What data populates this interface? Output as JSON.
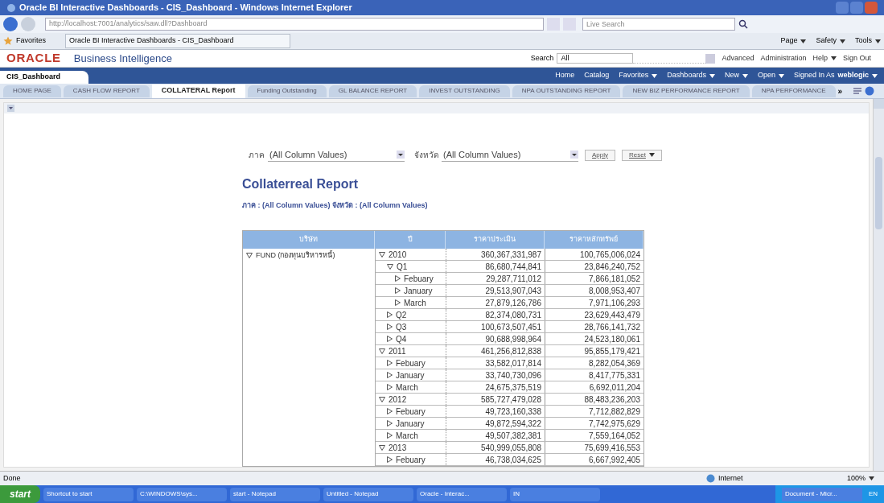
{
  "window": {
    "title": "Oracle BI Interactive Dashboards - CIS_Dashboard - Windows Internet Explorer"
  },
  "browser": {
    "address": "http://localhost:7001/analytics/saw.dll?Dashboard",
    "search_placeholder": "Live Search",
    "favorites": "Favorites",
    "page_tab": "Oracle BI Interactive Dashboards - CIS_Dashboard",
    "commands": [
      "Page",
      "Safety",
      "Tools"
    ]
  },
  "header": {
    "logo": "ORACLE",
    "product": "Business Intelligence",
    "search_label": "Search",
    "search_scope": "All",
    "links": [
      {
        "label": "Advanced",
        "menu": false
      },
      {
        "label": "Administration",
        "menu": false
      },
      {
        "label": "Help",
        "menu": true
      },
      {
        "label": "Sign Out",
        "menu": false
      }
    ]
  },
  "nav": {
    "dashboard": "CIS_Dashboard",
    "items": [
      {
        "label": "Home",
        "menu": false
      },
      {
        "label": "Catalog",
        "menu": false
      },
      {
        "label": "Favorites",
        "menu": true
      },
      {
        "label": "Dashboards",
        "menu": true
      },
      {
        "label": "New",
        "menu": true
      },
      {
        "label": "Open",
        "menu": true
      }
    ],
    "signed_in_label": "Signed In As",
    "user": "weblogic"
  },
  "tabs": [
    {
      "label": "HOME PAGE",
      "selected": false
    },
    {
      "label": "CASH FLOW REPORT",
      "selected": false
    },
    {
      "label": "COLLATERAL Report",
      "selected": true
    },
    {
      "label": "Funding Outstanding",
      "selected": false
    },
    {
      "label": "GL BALANCE REPORT",
      "selected": false
    },
    {
      "label": "INVEST OUTSTANDING",
      "selected": false
    },
    {
      "label": "NPA OUTSTANDING REPORT",
      "selected": false
    },
    {
      "label": "NEW BIZ PERFORMANCE REPORT",
      "selected": false
    },
    {
      "label": "NPA PERFORMANCE",
      "selected": false
    }
  ],
  "tabs_more": "»",
  "filters": [
    {
      "label": "ภาค",
      "value": "(All Column Values)"
    },
    {
      "label": "จังหวัด",
      "value": "(All Column Values)"
    }
  ],
  "filter_buttons": [
    "Apply",
    "Reset"
  ],
  "report": {
    "title": "Collaterreal Report",
    "subtitle": "ภาค : (All Column Values) จังหวัด : (All Column Values)"
  },
  "table": {
    "columns": [
      "บริษัท",
      "ปี",
      "ราคาประเมิน",
      "ราคาหลักทรัพย์"
    ],
    "group": {
      "label": "FUND (กองทุนบริหารหนี้)",
      "expanded": true
    },
    "rows": [
      {
        "label": "2010",
        "expanded": true,
        "values": [
          "360,367,331,987",
          "100,765,006,024"
        ],
        "children": [
          {
            "label": "Q1",
            "expanded": true,
            "values": [
              "86,680,744,841",
              "23,846,240,752"
            ],
            "children": [
              {
                "label": "Febuary",
                "expanded": false,
                "values": [
                  "29,287,711,012",
                  "7,866,181,052"
                ]
              },
              {
                "label": "January",
                "expanded": false,
                "values": [
                  "29,513,907,043",
                  "8,008,953,407"
                ]
              },
              {
                "label": "March",
                "expanded": false,
                "values": [
                  "27,879,126,786",
                  "7,971,106,293"
                ]
              }
            ]
          },
          {
            "label": "Q2",
            "expanded": false,
            "values": [
              "82,374,080,731",
              "23,629,443,479"
            ]
          },
          {
            "label": "Q3",
            "expanded": false,
            "values": [
              "100,673,507,451",
              "28,766,141,732"
            ]
          },
          {
            "label": "Q4",
            "expanded": false,
            "values": [
              "90,688,998,964",
              "24,523,180,061"
            ]
          }
        ]
      },
      {
        "label": "2011",
        "expanded": true,
        "values": [
          "461,256,812,838",
          "95,855,179,421"
        ],
        "children": [
          {
            "label": "Febuary",
            "expanded": false,
            "values": [
              "33,582,017,814",
              "8,282,054,369"
            ]
          },
          {
            "label": "January",
            "expanded": false,
            "values": [
              "33,740,730,096",
              "8,417,775,331"
            ]
          },
          {
            "label": "March",
            "expanded": false,
            "values": [
              "24,675,375,519",
              "6,692,011,204"
            ]
          }
        ]
      },
      {
        "label": "2012",
        "expanded": true,
        "values": [
          "585,727,479,028",
          "88,483,236,203"
        ],
        "children": [
          {
            "label": "Febuary",
            "expanded": false,
            "values": [
              "49,723,160,338",
              "7,712,882,829"
            ]
          },
          {
            "label": "January",
            "expanded": false,
            "values": [
              "49,872,594,322",
              "7,742,975,629"
            ]
          },
          {
            "label": "March",
            "expanded": false,
            "values": [
              "49,507,382,381",
              "7,559,164,052"
            ]
          }
        ]
      },
      {
        "label": "2013",
        "expanded": true,
        "values": [
          "540,999,055,808",
          "75,699,416,553"
        ],
        "children": [
          {
            "label": "Febuary",
            "expanded": false,
            "values": [
              "46,738,034,625",
              "6,667,992,405"
            ]
          }
        ]
      }
    ]
  },
  "status_bar": {
    "text": "Done",
    "zone": "Internet",
    "zoom": "100%"
  },
  "taskbar": {
    "start": "start",
    "items": [
      "Shortcut to start",
      "C:\\WINDOWS\\sys...",
      "start - Notepad",
      "Untitled - Notepad",
      "Oracle - Interac...",
      "IN"
    ],
    "tray_item": "Document - Micr...",
    "lang": "EN"
  }
}
